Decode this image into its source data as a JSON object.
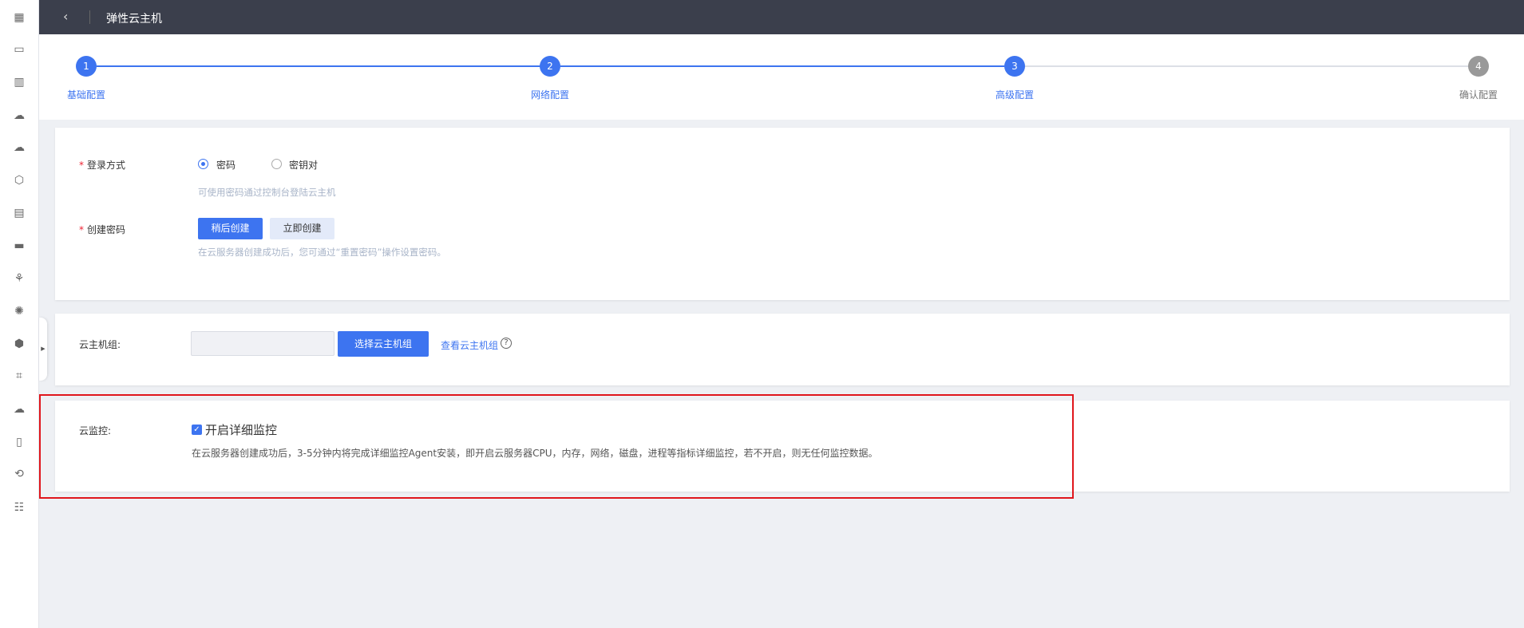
{
  "header": {
    "title": "弹性云主机",
    "back_icon": "chevron-left-icon"
  },
  "steps": [
    {
      "number": "1",
      "label": "基础配置",
      "state": "done"
    },
    {
      "number": "2",
      "label": "网络配置",
      "state": "done"
    },
    {
      "number": "3",
      "label": "高级配置",
      "state": "active"
    },
    {
      "number": "4",
      "label": "确认配置",
      "state": "pending"
    }
  ],
  "login": {
    "label": "登录方式",
    "required": "*",
    "options": [
      "密码",
      "密钥对"
    ],
    "selected": "密码",
    "hint": "可使用密码通过控制台登陆云主机"
  },
  "password": {
    "label": "创建密码",
    "required": "*",
    "buttons": [
      "稍后创建",
      "立即创建"
    ],
    "hint": "在云服务器创建成功后，您可通过“重置密码”操作设置密码。"
  },
  "group": {
    "label": "云主机组:",
    "input_value": "",
    "select_button": "选择云主机组",
    "view_link": "查看云主机组",
    "help": "?"
  },
  "monitor": {
    "label": "云监控:",
    "checkbox_label": "开启详细监控",
    "checked": true,
    "description": "在云服务器创建成功后，3-5分钟内将完成详细监控Agent安装，即开启云服务器CPU，内存，网络，磁盘，进程等指标详细监控，若不开启，则无任何监控数据。"
  },
  "colors": {
    "accent": "#3d74f0",
    "header_bg": "#3b3f4c",
    "highlight": "#e0161c"
  }
}
